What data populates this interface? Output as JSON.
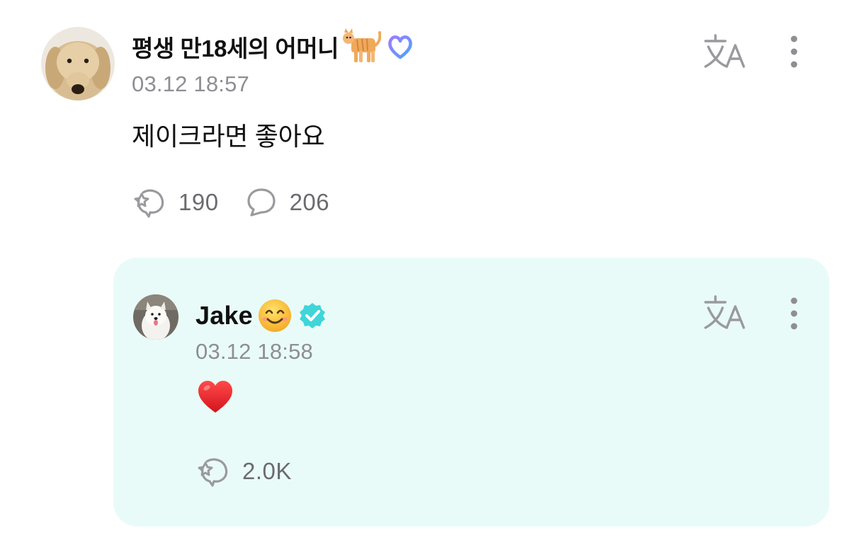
{
  "comment": {
    "author_name": "평생 만18세의 어머니",
    "author_emoji": "cat-emoji",
    "badge_icon": "heart-outline-badge-icon",
    "timestamp": "03.12 18:57",
    "text": "제이크라면 좋아요",
    "like_count": "190",
    "reply_count": "206",
    "translate_icon": "translate-icon",
    "more_icon": "more-vertical-icon"
  },
  "reply": {
    "author_name": "Jake",
    "author_emoji": "smiling-face-emoji",
    "badge_icon": "verified-badge-icon",
    "timestamp": "03.12 18:58",
    "body_emoji": "red-heart-emoji",
    "like_count": "2.0K",
    "translate_icon": "translate-icon",
    "more_icon": "more-vertical-icon"
  },
  "colors": {
    "reply_background": "#e9fbf8",
    "muted_text": "#8e8e93",
    "verified_teal": "#3fd5d9",
    "icon_gray": "#9a9a9e"
  }
}
